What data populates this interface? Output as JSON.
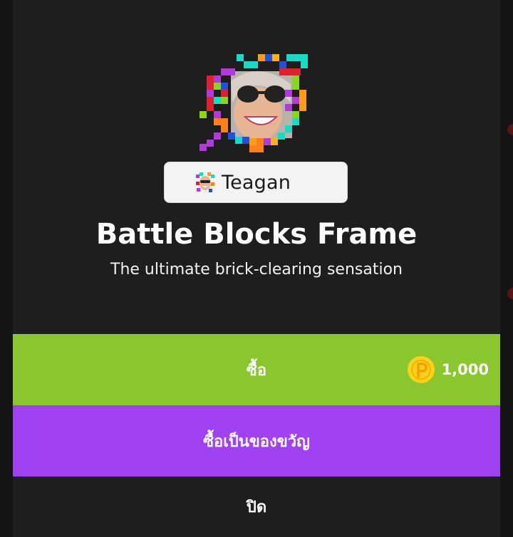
{
  "preview": {
    "username": "Teagan"
  },
  "item": {
    "title": "Battle Blocks Frame",
    "subtitle": "The ultimate brick-clearing sensation"
  },
  "actions": {
    "buy_label": "ซื้อ",
    "price": "1,000",
    "gift_label": "ซื้อเป็นของขวัญ",
    "close_label": "ปิด"
  },
  "colors": {
    "dialog_bg": "#1e1e1e",
    "buy_button": "#8ac62e",
    "gift_button": "#a041f2",
    "coin": "#ffd21a"
  },
  "icons": {
    "frame_preview": "tetris-block-frame-avatar",
    "chip_avatar": "mini-avatar-icon",
    "currency": "coin-icon"
  }
}
